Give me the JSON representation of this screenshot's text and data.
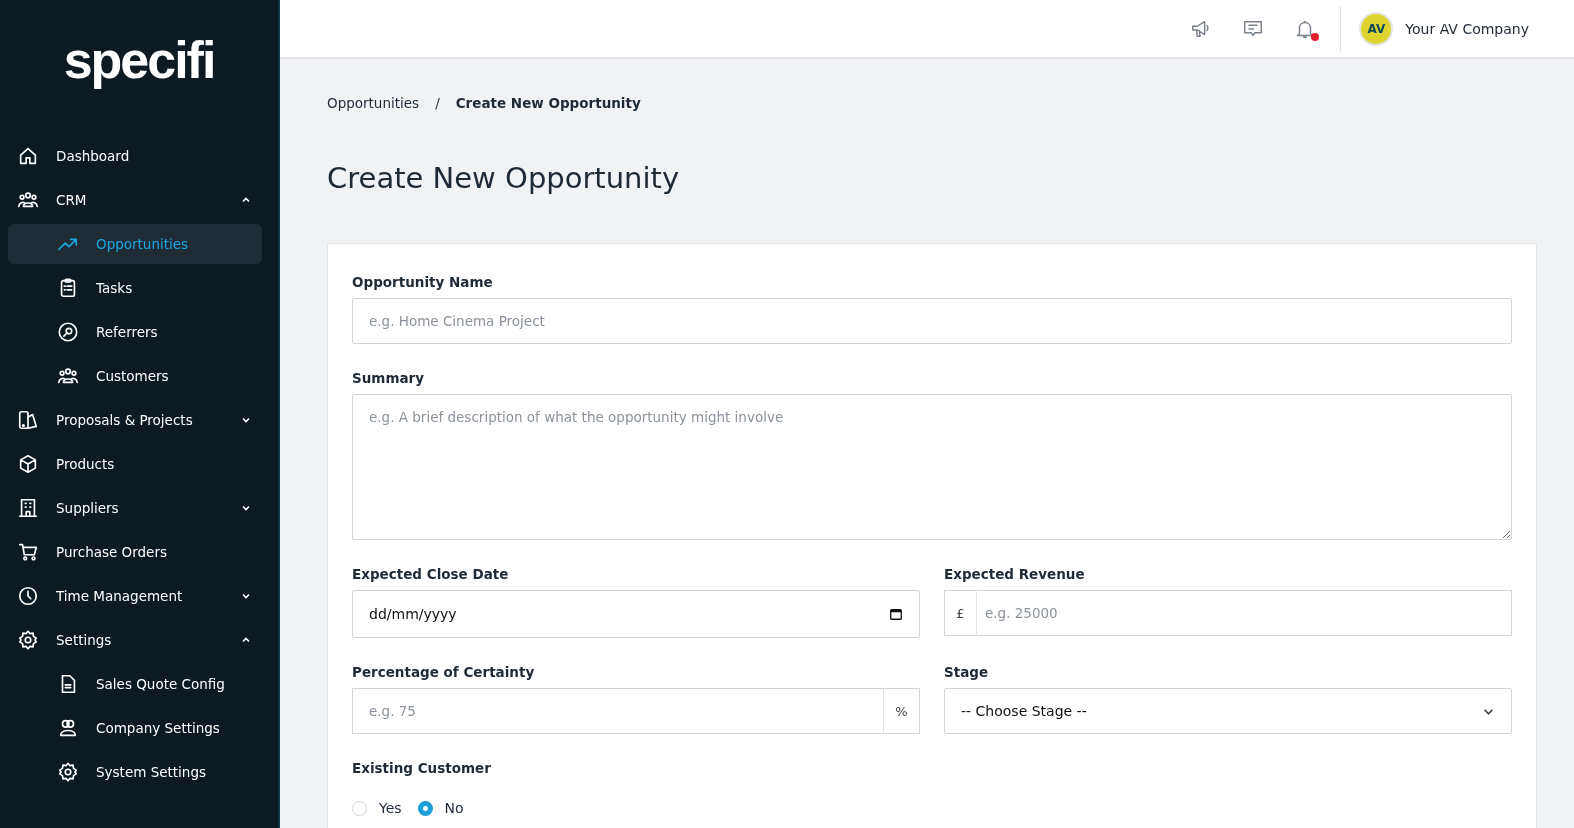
{
  "logo": {
    "text": "specifi"
  },
  "sidebar": {
    "items": [
      {
        "label": "Dashboard",
        "selected": false
      },
      {
        "label": "CRM",
        "selected": false,
        "expanded": true,
        "children": [
          {
            "label": "Opportunities",
            "selected": true
          },
          {
            "label": "Tasks",
            "selected": false
          },
          {
            "label": "Referrers",
            "selected": false
          },
          {
            "label": "Customers",
            "selected": false
          }
        ]
      },
      {
        "label": "Proposals & Projects",
        "selected": false,
        "expanded": false
      },
      {
        "label": "Products",
        "selected": false
      },
      {
        "label": "Suppliers",
        "selected": false,
        "expanded": false
      },
      {
        "label": "Purchase Orders",
        "selected": false
      },
      {
        "label": "Time Management",
        "selected": false,
        "expanded": false
      },
      {
        "label": "Settings",
        "selected": false,
        "expanded": true,
        "children": [
          {
            "label": "Sales Quote Config",
            "selected": false
          },
          {
            "label": "Company Settings",
            "selected": false
          },
          {
            "label": "System Settings",
            "selected": false
          }
        ]
      }
    ]
  },
  "topbar": {
    "notifications_unread": true,
    "avatar_initials": "AV",
    "company": "Your AV Company"
  },
  "breadcrumb": [
    "Opportunities",
    "/",
    "Create New Opportunity"
  ],
  "page_title": "Create New Opportunity",
  "form": {
    "fields": [
      {
        "kind": "text",
        "label": "Opportunity Name",
        "placeholder": "e.g. Home Cinema Project"
      },
      {
        "kind": "textarea",
        "label": "Summary",
        "placeholder": "e.g. A brief description of what the opportunity might involve"
      },
      {
        "kind": "date",
        "label": "Expected Close Date",
        "value": "dd/mm/yyyy"
      },
      {
        "kind": "prefix",
        "label": "Expected Revenue",
        "addon": "£",
        "placeholder": "e.g. 25000"
      },
      {
        "kind": "suffix",
        "label": "Percentage of Certainty",
        "addon": "%",
        "placeholder": "e.g. 75"
      },
      {
        "kind": "select",
        "label": "Stage",
        "value": "-- Choose Stage --"
      },
      {
        "kind": "radio",
        "label": "Existing Customer",
        "options": [
          {
            "label": "Yes",
            "selected": false
          },
          {
            "label": "No",
            "selected": true
          }
        ]
      }
    ]
  }
}
